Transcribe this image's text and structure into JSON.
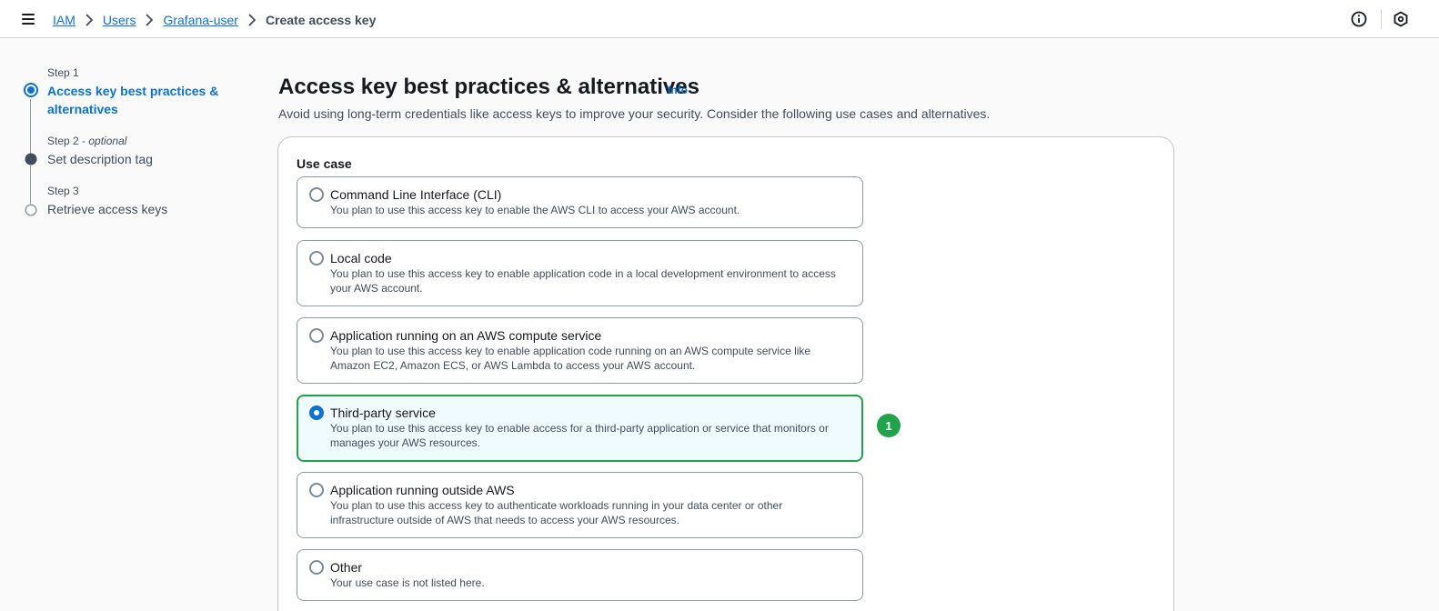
{
  "breadcrumb": {
    "items": [
      "IAM",
      "Users",
      "Grafana-user"
    ],
    "current": "Create access key"
  },
  "icons": {
    "menu": "hamburger-menu-icon",
    "info": "info-circle-icon",
    "settings": "hexagon-gear-icon",
    "separator": "chevron-right-icon"
  },
  "steps": [
    {
      "number": "Step 1",
      "optional": "",
      "title_line1": "Access key best practices &",
      "title_line2": "alternatives",
      "state": "active"
    },
    {
      "number": "Step 2",
      "optional": "optional",
      "title_line1": "Set description tag",
      "title_line2": "",
      "state": "completed"
    },
    {
      "number": "Step 3",
      "optional": "",
      "title_line1": "Retrieve access keys",
      "title_line2": "",
      "state": "pending"
    }
  ],
  "main": {
    "title": "Access key best practices & alternatives",
    "info_label": "Info",
    "description": "Avoid using long-term credentials like access keys to improve your security. Consider the following use cases and alternatives.",
    "use_case_label": "Use case",
    "options": [
      {
        "title": "Command Line Interface (CLI)",
        "desc_line1": "You plan to use this access key to enable the AWS CLI to access your AWS account.",
        "desc_line2": "",
        "selected": false
      },
      {
        "title": "Local code",
        "desc_line1": "You plan to use this access key to enable application code in a local development environment to access",
        "desc_line2": "your AWS account.",
        "selected": false
      },
      {
        "title": "Application running on an AWS compute service",
        "desc_line1": "You plan to use this access key to enable application code running on an AWS compute service like",
        "desc_line2": "Amazon EC2, Amazon ECS, or AWS Lambda to access your AWS account.",
        "selected": false
      },
      {
        "title": "Third-party service",
        "desc_line1": "You plan to use this access key to enable access for a third-party application or service that monitors or",
        "desc_line2": "manages your AWS resources.",
        "selected": true
      },
      {
        "title": "Application running outside AWS",
        "desc_line1": "You plan to use this access key to authenticate workloads running in your data center or other",
        "desc_line2": "infrastructure outside of AWS that needs to access your AWS resources.",
        "selected": false
      },
      {
        "title": "Other",
        "desc_line1": "Your use case is not listed here.",
        "desc_line2": "",
        "selected": false
      }
    ]
  },
  "annotation_badge": "1",
  "colors": {
    "link": "#0972d3",
    "selected_border": "#21a34a",
    "badge": "#21a34a"
  }
}
